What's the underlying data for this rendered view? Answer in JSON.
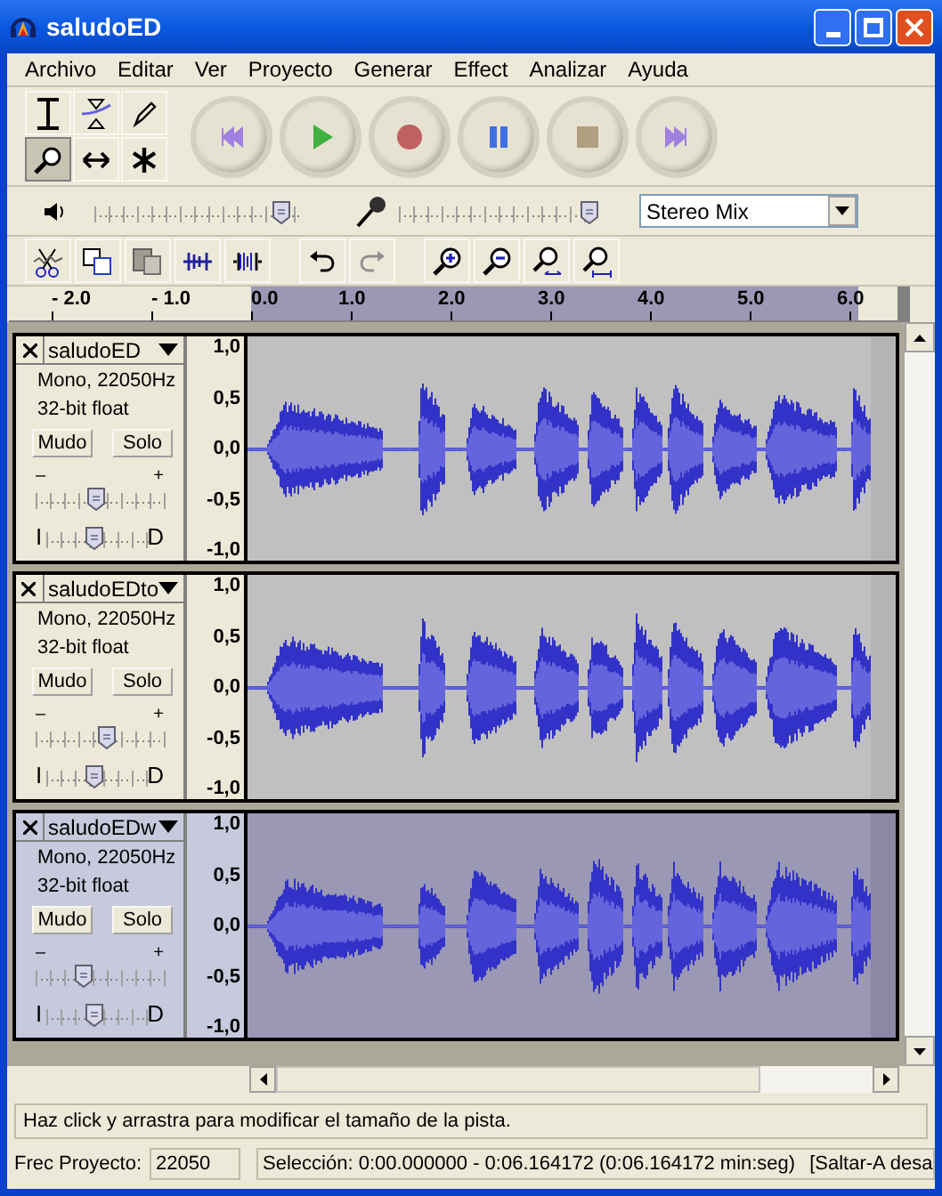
{
  "window": {
    "title": "saludoED"
  },
  "menu": [
    "Archivo",
    "Editar",
    "Ver",
    "Proyecto",
    "Generar",
    "Effect",
    "Analizar",
    "Ayuda"
  ],
  "tools": [
    {
      "kind": "select",
      "selected": false
    },
    {
      "kind": "envelope",
      "selected": false
    },
    {
      "kind": "draw",
      "selected": false
    },
    {
      "kind": "zoom",
      "selected": true
    },
    {
      "kind": "timeshift",
      "selected": false
    },
    {
      "kind": "multi",
      "selected": false
    }
  ],
  "mixer": {
    "playback": {
      "level": 0.95
    },
    "record": {
      "level": 1.0
    },
    "input_source": "Stereo Mix"
  },
  "ruler": {
    "labels": [
      "- 2.0",
      "- 1.0",
      "0.0",
      "1.0",
      "2.0",
      "3.0",
      "4.0",
      "5.0",
      "6.0"
    ]
  },
  "tracks": [
    {
      "name": "saludoED",
      "info": "Mono, 22050Hz",
      "format": "32-bit float",
      "mute": "Mudo",
      "solo": "Solo",
      "gain_min": "–",
      "gain_max": "+",
      "pan_left": "I",
      "pan_right": "D",
      "gain": {
        "level": 0.45
      },
      "pan": {
        "level": 0.5
      },
      "selected": false,
      "scale": [
        "1,0",
        "0,5",
        "0,0",
        "-0,5",
        "-1,0"
      ]
    },
    {
      "name": "saludoEDto",
      "info": "Mono, 22050Hz",
      "format": "32-bit float",
      "mute": "Mudo",
      "solo": "Solo",
      "gain_min": "–",
      "gain_max": "+",
      "pan_left": "I",
      "pan_right": "D",
      "gain": {
        "level": 0.55
      },
      "pan": {
        "level": 0.5
      },
      "selected": false,
      "scale": [
        "1,0",
        "0,5",
        "0,0",
        "-0,5",
        "-1,0"
      ]
    },
    {
      "name": "saludoEDw",
      "info": "Mono, 22050Hz",
      "format": "32-bit float",
      "mute": "Mudo",
      "solo": "Solo",
      "gain_min": "–",
      "gain_max": "+",
      "pan_left": "I",
      "pan_right": "D",
      "gain": {
        "level": 0.35
      },
      "pan": {
        "level": 0.5
      },
      "selected": true,
      "scale": [
        "1,0",
        "0,5",
        "0,0",
        "-0,5",
        "-1,0"
      ]
    }
  ],
  "status": {
    "message": "Haz click y arrastra para modificar el tamaño de la pista.",
    "rate_label": "Frec Proyecto:",
    "rate": "22050",
    "selection": "Selección: 0:00.000000 - 0:06.164172 (0:06.164172 min:seg)",
    "snap": "[Saltar-A desa"
  }
}
